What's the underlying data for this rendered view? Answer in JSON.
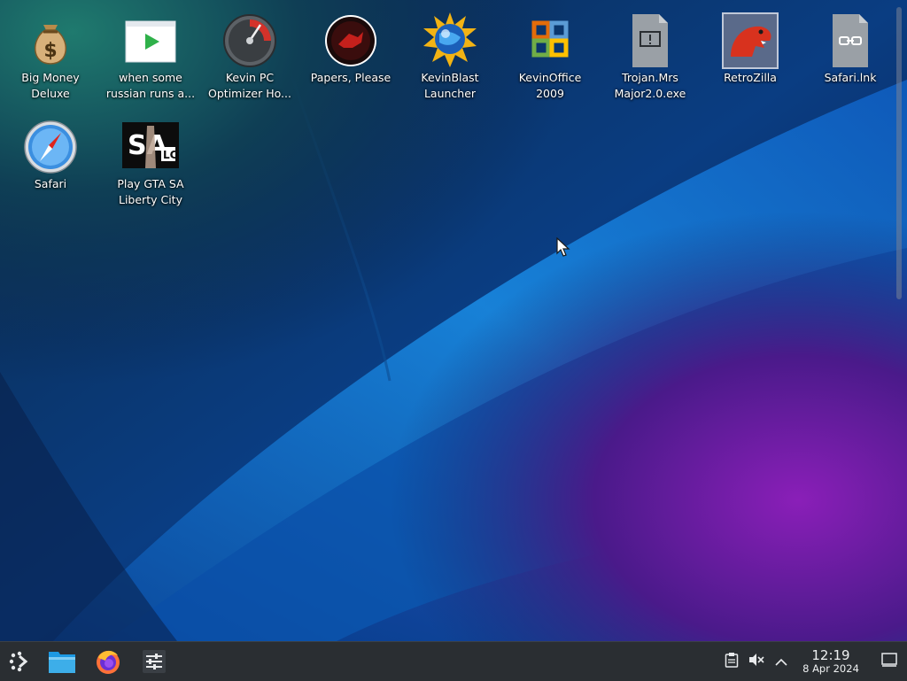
{
  "desktop": {
    "icons": [
      {
        "label": "Big Money\nDeluxe",
        "icon": "money-bag-icon"
      },
      {
        "label": "when some\nrussian runs a...",
        "icon": "video-window-icon"
      },
      {
        "label": "Kevin PC\nOptimizer Ho...",
        "icon": "speedometer-icon"
      },
      {
        "label": "Papers, Please",
        "icon": "red-seal-icon"
      },
      {
        "label": "KevinBlast\nLauncher",
        "icon": "sun-globe-icon"
      },
      {
        "label": "KevinOffice\n2009",
        "icon": "office-knot-icon"
      },
      {
        "label": "Trojan.Mrs\nMajor2.0.exe",
        "icon": "executable-file-icon"
      },
      {
        "label": "RetroZilla",
        "icon": "dinosaur-icon"
      },
      {
        "label": "Safari.lnk",
        "icon": "link-file-icon"
      },
      {
        "label": "Safari",
        "icon": "compass-icon"
      },
      {
        "label": "Play GTA SA\nLiberty City",
        "icon": "sa-lc-logo-icon"
      }
    ]
  },
  "taskbar": {
    "launchers": [
      {
        "name": "application-launcher",
        "icon": "kde-launcher-icon"
      },
      {
        "name": "file-manager",
        "icon": "folder-icon"
      },
      {
        "name": "firefox",
        "icon": "firefox-icon"
      },
      {
        "name": "system-settings",
        "icon": "sliders-icon"
      }
    ],
    "tray": {
      "clipboard_icon": "clipboard-icon",
      "volume_icon": "volume-muted-icon",
      "expand_icon": "chevron-up-icon",
      "time": "12:19",
      "date": "8 Apr 2024",
      "show_desktop_icon": "show-desktop-icon"
    }
  },
  "colors": {
    "taskbar_bg": "#2a2e32",
    "wallpaper_blue": "#1a86e0",
    "wallpaper_purple": "#7a1bb0",
    "wallpaper_teal": "#1a6a6a"
  }
}
